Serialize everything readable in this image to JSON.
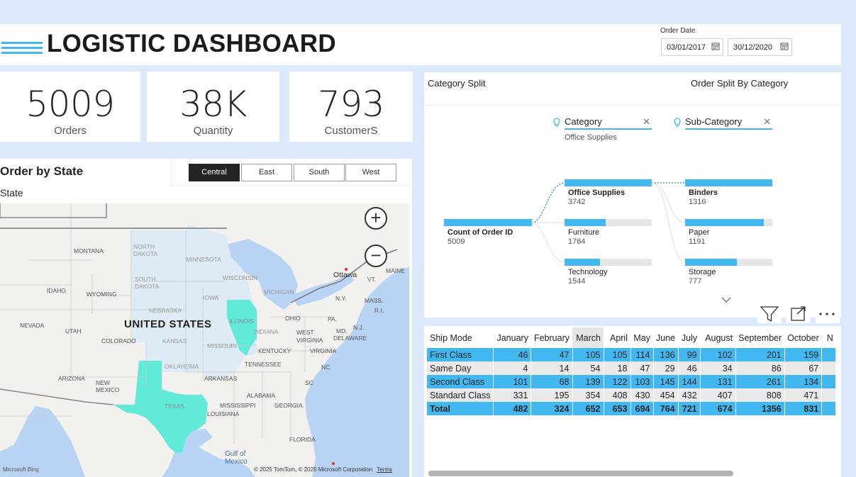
{
  "header": {
    "title": "LOGISTIC DASHBOARD"
  },
  "date_filter": {
    "label": "Order Date",
    "start": "03/01/2017",
    "end": "30/12/2020"
  },
  "kpis": [
    {
      "value": "5009",
      "label": "Orders"
    },
    {
      "value": "38K",
      "label": "Quantity"
    },
    {
      "value": "793",
      "label": "CustomerS"
    }
  ],
  "map": {
    "title": "Order by State",
    "subtitle": "State",
    "regions": [
      "Central",
      "East",
      "South",
      "West"
    ],
    "selected_region": "Central",
    "zoom_in": "+",
    "zoom_out": "−",
    "country_label": "UNITED STATES",
    "labels": {
      "montana": "MONTANA",
      "north_dakota": "NORTH DAKOTA",
      "minnesota": "MINNESOTA",
      "south_dakota": "SOUTH DAKOTA",
      "wisconsin": "WISCONSIN",
      "michigan": "MICHIGAN",
      "idaho": "IDAHO",
      "wyoming": "WYOMING",
      "iowa": "IOWA",
      "nebraska": "NEBRASKA",
      "nevada": "NEVADA",
      "utah": "UTAH",
      "colorado": "COLORADO",
      "kansas": "KANSAS",
      "illinois": "ILLINOIS",
      "indiana": "INDIANA",
      "ohio": "OHIO",
      "missouri": "MISSOURI",
      "west_virginia": "WEST VIRGINIA",
      "kentucky": "KENTUCKY",
      "virginia": "VIRGINIA",
      "arizona": "ARIZONA",
      "new_mexico": "NEW MEXICO",
      "oklahoma": "OKLAHOMA",
      "arkansas": "ARKANSAS",
      "tennessee": "TENNESSEE",
      "nc": "NC",
      "sc": "SC",
      "alabama": "ALABAMA",
      "mississippi": "MISSISSIPPI",
      "georgia": "GEORGIA",
      "texas": "TEXAS",
      "louisiana": "LOUISIANA",
      "florida": "FLORIDA",
      "gulf": "Gulf of\nMexico",
      "ottawa": "Ottawa",
      "maine": "MAINE",
      "vt": "VT.",
      "ny": "N.Y.",
      "mass": "MASS.",
      "ri": "R.I.",
      "nj": "N.J.",
      "md": "MD.",
      "delaware": "DELAWARE",
      "pa": "PA."
    },
    "bing": "Microsoft Bing",
    "copyright": "© 2025 TomTom, © 2025 Microsoft Corporation",
    "terms": "Terms",
    "colors": {
      "highlight": "#62ead8",
      "central": "#dceaf7",
      "water": "#b9d3f5",
      "land": "#f2f1ee"
    }
  },
  "tree": {
    "title_left": "Category Split",
    "title_right": "Order Split By Category",
    "level1": {
      "header": "Category",
      "filter": "Office Supplies"
    },
    "level2": {
      "header": "Sub-Category"
    },
    "root": {
      "label": "Count of Order ID",
      "value": "5009"
    },
    "categories": [
      {
        "label": "Office Supplies",
        "value": "3742",
        "fraction": 1.0
      },
      {
        "label": "Furniture",
        "value": "1764",
        "fraction": 0.47
      },
      {
        "label": "Technology",
        "value": "1544",
        "fraction": 0.41
      }
    ],
    "subcategories": [
      {
        "label": "Binders",
        "value": "1316",
        "fraction": 1.0
      },
      {
        "label": "Paper",
        "value": "1191",
        "fraction": 0.9
      },
      {
        "label": "Storage",
        "value": "777",
        "fraction": 0.59
      }
    ]
  },
  "matrix": {
    "corner": "Ship Mode",
    "months": [
      "January",
      "February",
      "March",
      "April",
      "May",
      "June",
      "July",
      "August",
      "September",
      "October",
      "N"
    ],
    "selected_month": "March",
    "rows": [
      {
        "label": "First Class",
        "values": [
          "46",
          "47",
          "105",
          "105",
          "114",
          "136",
          "99",
          "102",
          "201",
          "159"
        ]
      },
      {
        "label": "Same Day",
        "values": [
          "4",
          "14",
          "54",
          "18",
          "47",
          "29",
          "46",
          "34",
          "86",
          "67"
        ]
      },
      {
        "label": "Second Class",
        "values": [
          "101",
          "68",
          "139",
          "122",
          "103",
          "145",
          "144",
          "131",
          "261",
          "134"
        ]
      },
      {
        "label": "Standard Class",
        "values": [
          "331",
          "195",
          "354",
          "408",
          "430",
          "454",
          "432",
          "407",
          "808",
          "471"
        ]
      }
    ],
    "total": {
      "label": "Total",
      "values": [
        "482",
        "324",
        "652",
        "653",
        "694",
        "764",
        "721",
        "674",
        "1356",
        "831"
      ]
    }
  }
}
